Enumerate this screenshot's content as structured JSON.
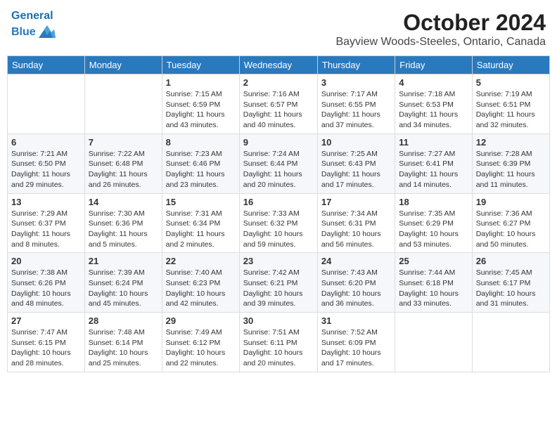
{
  "header": {
    "logo_line1": "General",
    "logo_line2": "Blue",
    "month": "October 2024",
    "location": "Bayview Woods-Steeles, Ontario, Canada"
  },
  "days_of_week": [
    "Sunday",
    "Monday",
    "Tuesday",
    "Wednesday",
    "Thursday",
    "Friday",
    "Saturday"
  ],
  "weeks": [
    [
      {
        "day": "",
        "info": ""
      },
      {
        "day": "",
        "info": ""
      },
      {
        "day": "1",
        "info": "Sunrise: 7:15 AM\nSunset: 6:59 PM\nDaylight: 11 hours and 43 minutes."
      },
      {
        "day": "2",
        "info": "Sunrise: 7:16 AM\nSunset: 6:57 PM\nDaylight: 11 hours and 40 minutes."
      },
      {
        "day": "3",
        "info": "Sunrise: 7:17 AM\nSunset: 6:55 PM\nDaylight: 11 hours and 37 minutes."
      },
      {
        "day": "4",
        "info": "Sunrise: 7:18 AM\nSunset: 6:53 PM\nDaylight: 11 hours and 34 minutes."
      },
      {
        "day": "5",
        "info": "Sunrise: 7:19 AM\nSunset: 6:51 PM\nDaylight: 11 hours and 32 minutes."
      }
    ],
    [
      {
        "day": "6",
        "info": "Sunrise: 7:21 AM\nSunset: 6:50 PM\nDaylight: 11 hours and 29 minutes."
      },
      {
        "day": "7",
        "info": "Sunrise: 7:22 AM\nSunset: 6:48 PM\nDaylight: 11 hours and 26 minutes."
      },
      {
        "day": "8",
        "info": "Sunrise: 7:23 AM\nSunset: 6:46 PM\nDaylight: 11 hours and 23 minutes."
      },
      {
        "day": "9",
        "info": "Sunrise: 7:24 AM\nSunset: 6:44 PM\nDaylight: 11 hours and 20 minutes."
      },
      {
        "day": "10",
        "info": "Sunrise: 7:25 AM\nSunset: 6:43 PM\nDaylight: 11 hours and 17 minutes."
      },
      {
        "day": "11",
        "info": "Sunrise: 7:27 AM\nSunset: 6:41 PM\nDaylight: 11 hours and 14 minutes."
      },
      {
        "day": "12",
        "info": "Sunrise: 7:28 AM\nSunset: 6:39 PM\nDaylight: 11 hours and 11 minutes."
      }
    ],
    [
      {
        "day": "13",
        "info": "Sunrise: 7:29 AM\nSunset: 6:37 PM\nDaylight: 11 hours and 8 minutes."
      },
      {
        "day": "14",
        "info": "Sunrise: 7:30 AM\nSunset: 6:36 PM\nDaylight: 11 hours and 5 minutes."
      },
      {
        "day": "15",
        "info": "Sunrise: 7:31 AM\nSunset: 6:34 PM\nDaylight: 11 hours and 2 minutes."
      },
      {
        "day": "16",
        "info": "Sunrise: 7:33 AM\nSunset: 6:32 PM\nDaylight: 10 hours and 59 minutes."
      },
      {
        "day": "17",
        "info": "Sunrise: 7:34 AM\nSunset: 6:31 PM\nDaylight: 10 hours and 56 minutes."
      },
      {
        "day": "18",
        "info": "Sunrise: 7:35 AM\nSunset: 6:29 PM\nDaylight: 10 hours and 53 minutes."
      },
      {
        "day": "19",
        "info": "Sunrise: 7:36 AM\nSunset: 6:27 PM\nDaylight: 10 hours and 50 minutes."
      }
    ],
    [
      {
        "day": "20",
        "info": "Sunrise: 7:38 AM\nSunset: 6:26 PM\nDaylight: 10 hours and 48 minutes."
      },
      {
        "day": "21",
        "info": "Sunrise: 7:39 AM\nSunset: 6:24 PM\nDaylight: 10 hours and 45 minutes."
      },
      {
        "day": "22",
        "info": "Sunrise: 7:40 AM\nSunset: 6:23 PM\nDaylight: 10 hours and 42 minutes."
      },
      {
        "day": "23",
        "info": "Sunrise: 7:42 AM\nSunset: 6:21 PM\nDaylight: 10 hours and 39 minutes."
      },
      {
        "day": "24",
        "info": "Sunrise: 7:43 AM\nSunset: 6:20 PM\nDaylight: 10 hours and 36 minutes."
      },
      {
        "day": "25",
        "info": "Sunrise: 7:44 AM\nSunset: 6:18 PM\nDaylight: 10 hours and 33 minutes."
      },
      {
        "day": "26",
        "info": "Sunrise: 7:45 AM\nSunset: 6:17 PM\nDaylight: 10 hours and 31 minutes."
      }
    ],
    [
      {
        "day": "27",
        "info": "Sunrise: 7:47 AM\nSunset: 6:15 PM\nDaylight: 10 hours and 28 minutes."
      },
      {
        "day": "28",
        "info": "Sunrise: 7:48 AM\nSunset: 6:14 PM\nDaylight: 10 hours and 25 minutes."
      },
      {
        "day": "29",
        "info": "Sunrise: 7:49 AM\nSunset: 6:12 PM\nDaylight: 10 hours and 22 minutes."
      },
      {
        "day": "30",
        "info": "Sunrise: 7:51 AM\nSunset: 6:11 PM\nDaylight: 10 hours and 20 minutes."
      },
      {
        "day": "31",
        "info": "Sunrise: 7:52 AM\nSunset: 6:09 PM\nDaylight: 10 hours and 17 minutes."
      },
      {
        "day": "",
        "info": ""
      },
      {
        "day": "",
        "info": ""
      }
    ]
  ]
}
